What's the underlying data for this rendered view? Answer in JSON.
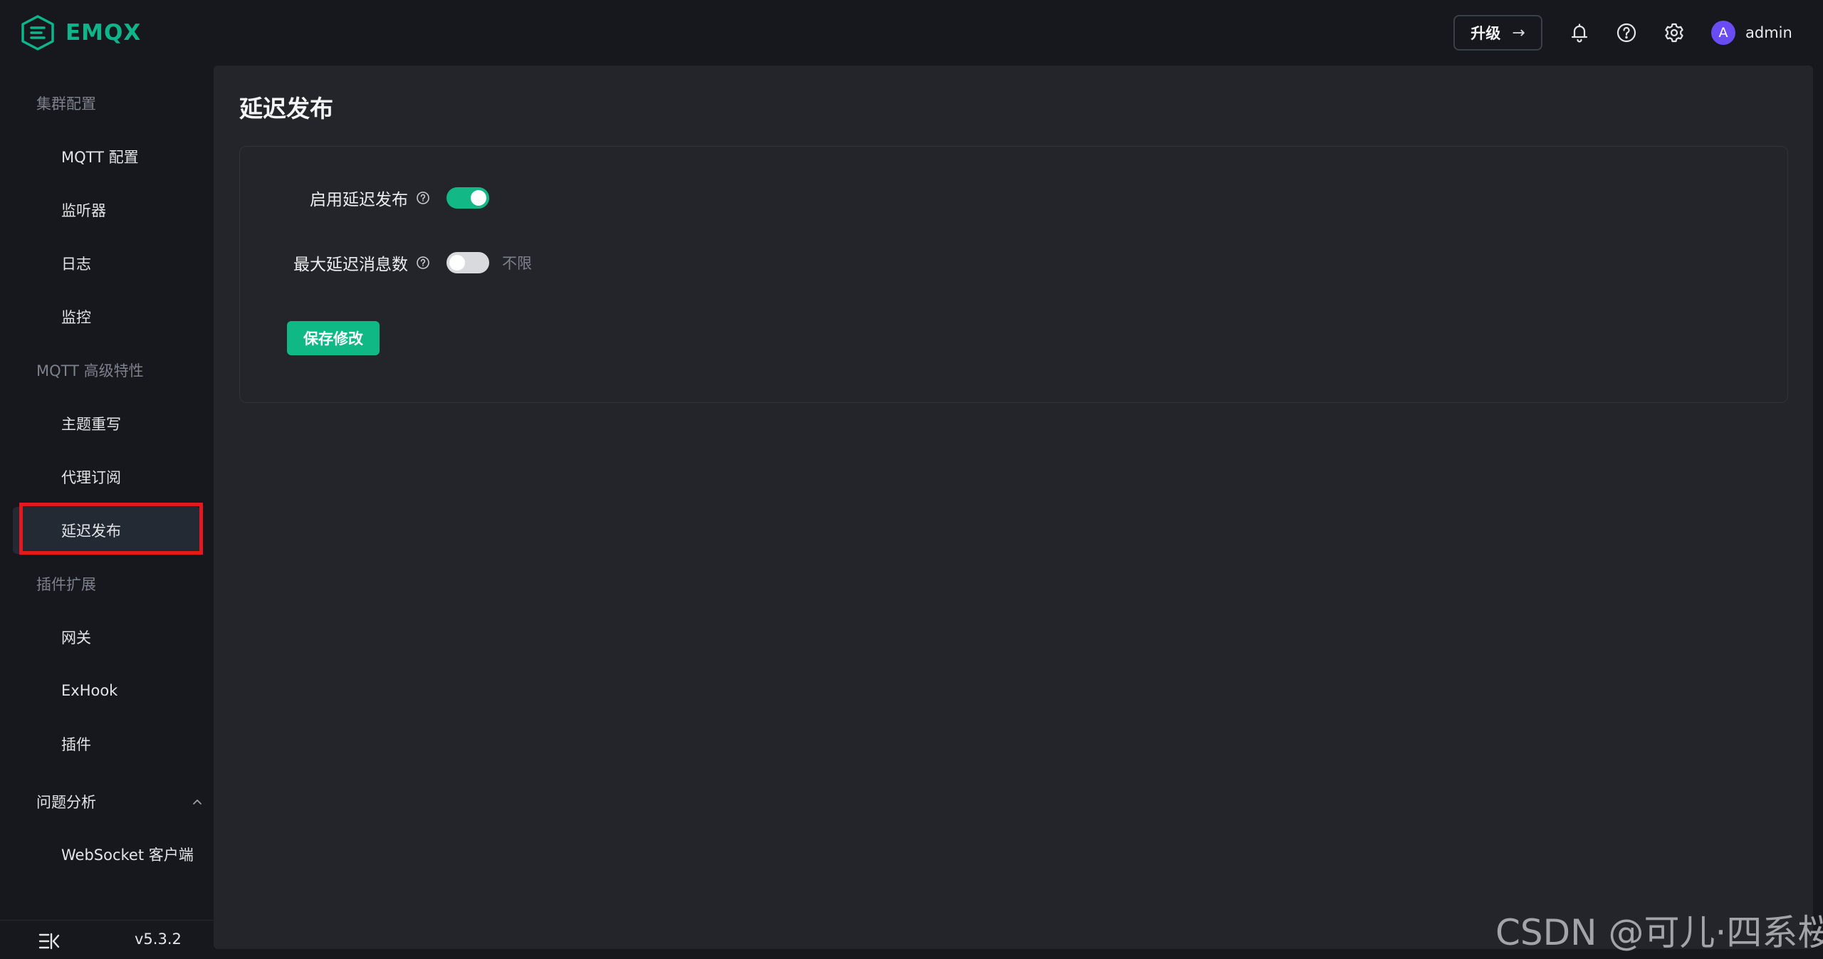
{
  "app": {
    "name": "EMQX",
    "brand_color": "#0fb48b"
  },
  "topbar": {
    "upgrade_label": "升级",
    "upgrade_arrow": "→",
    "user": {
      "avatar_letter": "A",
      "name": "admin",
      "avatar_color": "#6a4cf5"
    },
    "icons": [
      "bell-icon",
      "help-icon",
      "gear-icon"
    ]
  },
  "sidebar": {
    "groups": [
      {
        "label": "集群配置",
        "items": [
          "MQTT 配置",
          "监听器",
          "日志",
          "监控"
        ]
      },
      {
        "label": "MQTT 高级特性",
        "items": [
          "主题重写",
          "代理订阅",
          "延迟发布"
        ]
      },
      {
        "label": "插件扩展",
        "items": [
          "网关",
          "ExHook",
          "插件"
        ]
      },
      {
        "label": "问题分析",
        "items": [
          "WebSocket 客户端"
        ],
        "expanded": true
      }
    ],
    "active_item": "延迟发布",
    "version": "v5.3.2"
  },
  "main": {
    "title": "延迟发布",
    "form": {
      "enable_label": "启用延迟发布",
      "enable_value": true,
      "max_label": "最大延迟消息数",
      "max_value": false,
      "max_toggle_text": "不限",
      "save_label": "保存修改"
    }
  },
  "colors": {
    "accent": "#10b886",
    "highlight_outline": "#e3191f"
  },
  "watermark": "CSDN @可儿·四系桜"
}
